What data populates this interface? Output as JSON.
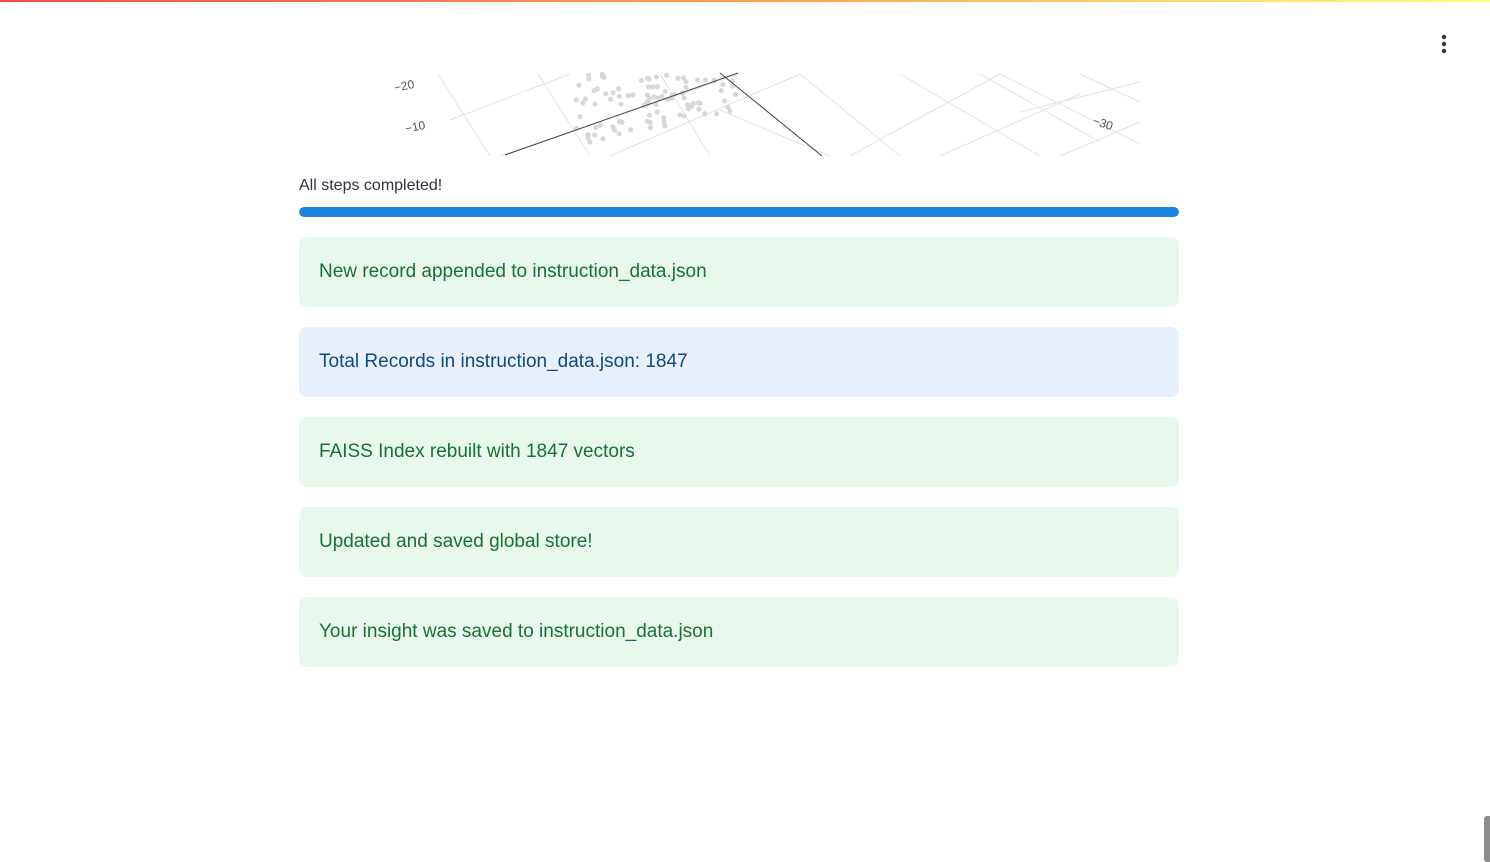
{
  "header": {
    "menu_icon": "kebab-menu-icon"
  },
  "plot": {
    "tick_labels": [
      "−20",
      "−10",
      "−30"
    ],
    "grid_color": "#e3e3e3",
    "point_color": "#d8d8d8",
    "axis_color": "#444444"
  },
  "progress": {
    "label": "All steps completed!",
    "value_percent": 100,
    "color": "#1c83e1"
  },
  "alerts": [
    {
      "type": "success",
      "text": "New record appended to instruction_data.json"
    },
    {
      "type": "info",
      "text": "Total Records in instruction_data.json: 1847"
    },
    {
      "type": "success",
      "text": "FAISS Index rebuilt with 1847 vectors"
    },
    {
      "type": "success",
      "text": "Updated and saved global store!"
    },
    {
      "type": "success",
      "text": "Your insight was saved to instruction_data.json"
    }
  ],
  "colors": {
    "success_bg": "#e8f8ec",
    "success_text": "#177233",
    "info_bg": "#e7f0fb",
    "info_text": "#0e4a85"
  }
}
